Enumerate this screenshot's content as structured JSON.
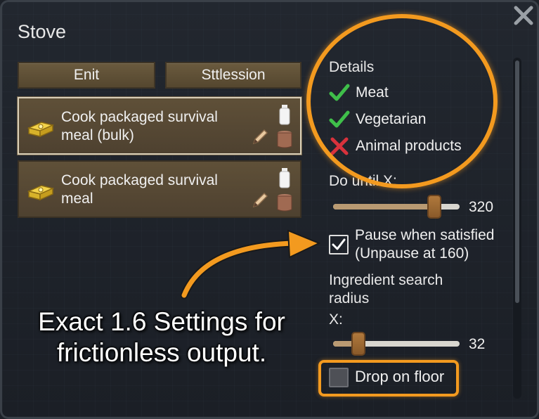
{
  "window": {
    "title": "Stove"
  },
  "buttons": {
    "left_label": "Enit",
    "right_label": "Sttlession"
  },
  "bills": [
    {
      "label": "Cook packaged survival meal (bulk)",
      "selected": true
    },
    {
      "label": "Cook packaged survival meal",
      "selected": false
    }
  ],
  "details": {
    "heading": "Details",
    "items": [
      {
        "label": "Meat",
        "allowed": true
      },
      {
        "label": "Vegetarian",
        "allowed": true
      },
      {
        "label": "Animal products",
        "allowed": false
      }
    ]
  },
  "do_until": {
    "label": "Do until X:",
    "value": "320",
    "fraction": 0.8
  },
  "pause": {
    "label": "Pause when satisfied (Unpause at 160)",
    "checked": true
  },
  "ingredient_radius": {
    "label": "Ingredient search radius",
    "sub_label": "X:",
    "value": "32",
    "fraction": 0.2
  },
  "drop": {
    "label": "Drop on floor",
    "checked": false
  },
  "caption": "Exact 1.6 Settings for frictionless output.",
  "colors": {
    "accent_orange": "#f39a1f",
    "check_green": "#3fbf4a",
    "cross_red": "#d8323c",
    "bill_brown": "#5f5038"
  }
}
